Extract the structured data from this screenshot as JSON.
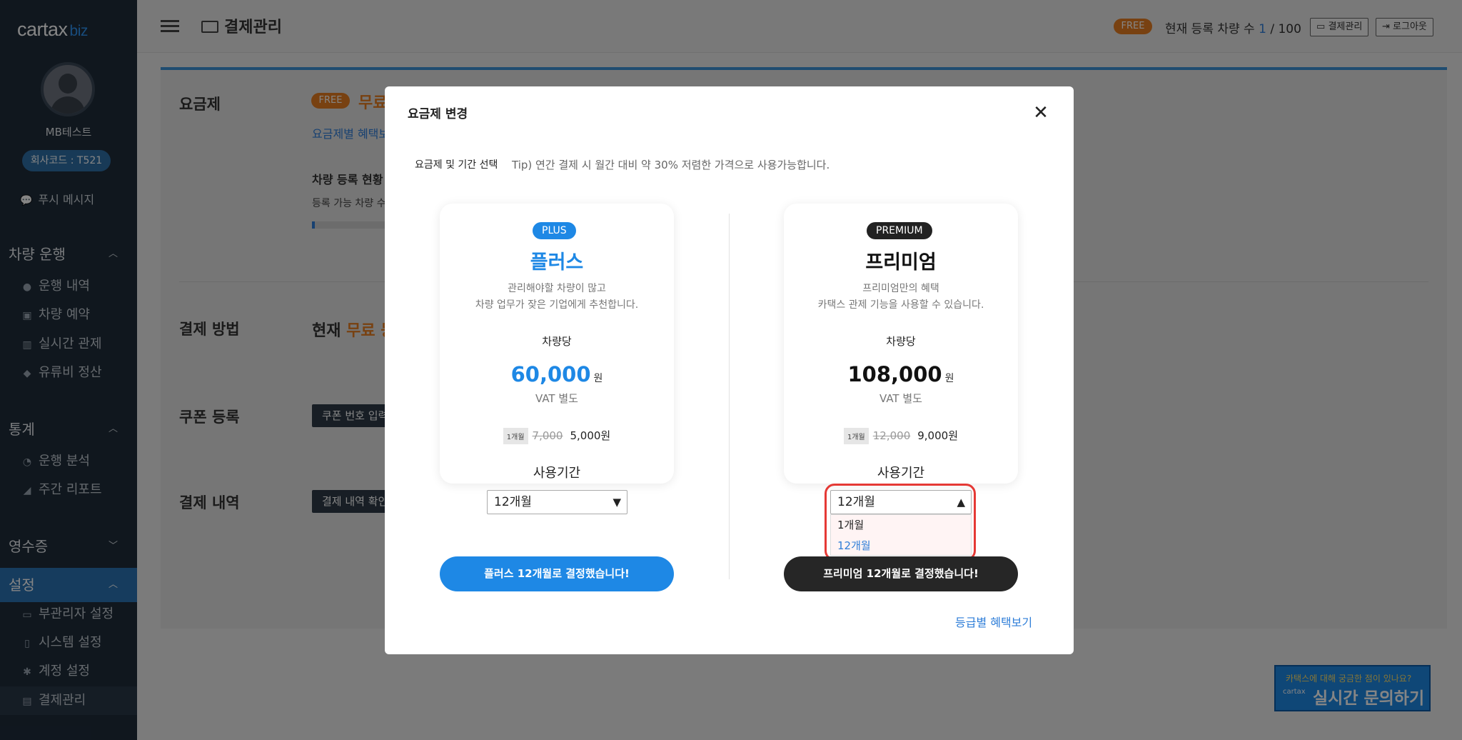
{
  "sidebar": {
    "logo": "cartax",
    "logo_suffix": "biz",
    "username": "MB테스트",
    "company_code": "회사코드 : T521",
    "push_message": "푸시 메시지",
    "sections": [
      {
        "label": "차량 운행",
        "items": [
          "운행 내역",
          "차량 예약",
          "실시간 관제",
          "유류비 정산"
        ]
      },
      {
        "label": "통계",
        "items": [
          "운행 분석",
          "주간 리포트"
        ]
      },
      {
        "label": "영수증",
        "items": []
      },
      {
        "label": "설정",
        "items": [
          "부관리자 설정",
          "시스템 설정",
          "계정 설정",
          "결제관리"
        ]
      }
    ]
  },
  "header": {
    "title": "결제관리",
    "plan_badge": "FREE",
    "vehicle_count_label": "현재 등록 차량 수",
    "vehicle_count_current": "1",
    "vehicle_count_max": "/ 100",
    "billing_button": "결제관리",
    "logout_button": "로그아웃"
  },
  "main": {
    "plan_section_label": "요금제",
    "free_chip": "FREE",
    "free_text": "무료",
    "benefit_link": "요금제별 혜택보",
    "vehicle_status_title": "차량 등록 현황",
    "vehicle_status_sub": "등록 가능 차량 수",
    "vehicle_progress": 0.01,
    "payment_section_label": "결제 방법",
    "payment_text_prefix": "현재",
    "payment_text_highlight": "무료 등",
    "coupon_section_label": "쿠폰 등록",
    "coupon_button": "쿠폰 번호 입력",
    "history_section_label": "결제 내역",
    "history_button": "결제 내역 확인"
  },
  "modal": {
    "title": "요금제 변경",
    "close": "✕",
    "select_label": "요금제 및 기간 선택",
    "tip": "Tip) 연간 결제 시 월간 대비 약 30% 저렴한 가격으로 사용가능합니다.",
    "plans": [
      {
        "badge": "PLUS",
        "name": "플러스",
        "desc_line1": "관리해야할 차량이 많고",
        "desc_line2": "차량 업무가 잦은 기업에게 추천합니다.",
        "per_car": "차량당",
        "price": "60,000",
        "currency": "원",
        "vat": "VAT 별도",
        "monthly_tag": "1개월",
        "monthly_original": "7,000",
        "monthly_price": "5,000원",
        "period_label": "사용기간",
        "period_value": "12개월",
        "cta": "플러스 12개월로 결정했습니다!",
        "accent": "#1e88e5"
      },
      {
        "badge": "PREMIUM",
        "name": "프리미엄",
        "desc_line1": "프리미엄만의 혜택",
        "desc_line2": "카택스 관제 기능을 사용할 수 있습니다.",
        "per_car": "차량당",
        "price": "108,000",
        "currency": "원",
        "vat": "VAT 별도",
        "monthly_tag": "1개월",
        "monthly_original": "12,000",
        "monthly_price": "9,000원",
        "period_label": "사용기간",
        "period_value": "12개월",
        "cta": "프리미엄 12개월로 결정했습니다!",
        "accent": "#222222"
      }
    ],
    "dropdown_options": [
      "1개월",
      "12개월"
    ],
    "dropdown_selected": "12개월",
    "benefit_link": "등급별 혜택보기"
  },
  "chat_banner": {
    "question": "카택스에 대해 궁금한 점이 있나요?",
    "brand": "cartax",
    "action": "실시간 문의하기"
  }
}
